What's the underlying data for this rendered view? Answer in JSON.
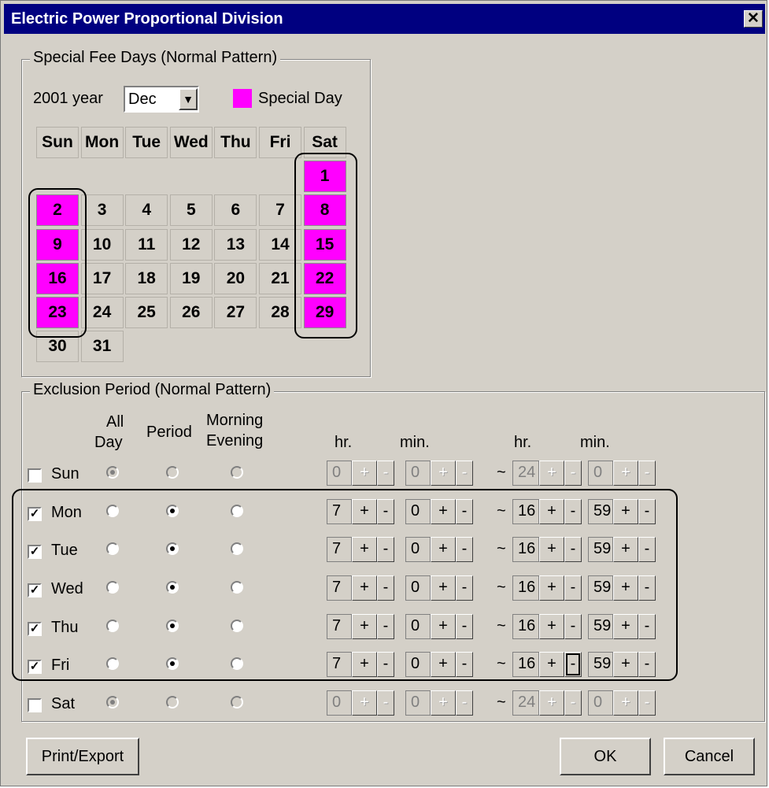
{
  "window": {
    "title": "Electric Power Proportional Division",
    "close_label": "✕"
  },
  "special_fee": {
    "legend": "Special Fee Days (Normal Pattern)",
    "year_label": "2001 year",
    "month_value": "Dec",
    "dropdown_arrow": "▼",
    "special_day_label": "Special Day",
    "special_color": "#ff00ff",
    "weekdays": [
      "Sun",
      "Mon",
      "Tue",
      "Wed",
      "Thu",
      "Fri",
      "Sat"
    ],
    "days": [
      {
        "d": "1",
        "special": true
      },
      {
        "d": "2",
        "special": true
      },
      {
        "d": "3",
        "special": false
      },
      {
        "d": "4",
        "special": false
      },
      {
        "d": "5",
        "special": false
      },
      {
        "d": "6",
        "special": false
      },
      {
        "d": "7",
        "special": false
      },
      {
        "d": "8",
        "special": true
      },
      {
        "d": "9",
        "special": true
      },
      {
        "d": "10",
        "special": false
      },
      {
        "d": "11",
        "special": false
      },
      {
        "d": "12",
        "special": false
      },
      {
        "d": "13",
        "special": false
      },
      {
        "d": "14",
        "special": false
      },
      {
        "d": "15",
        "special": true
      },
      {
        "d": "16",
        "special": true
      },
      {
        "d": "17",
        "special": false
      },
      {
        "d": "18",
        "special": false
      },
      {
        "d": "19",
        "special": false
      },
      {
        "d": "20",
        "special": false
      },
      {
        "d": "21",
        "special": false
      },
      {
        "d": "22",
        "special": true
      },
      {
        "d": "23",
        "special": true
      },
      {
        "d": "24",
        "special": false
      },
      {
        "d": "25",
        "special": false
      },
      {
        "d": "26",
        "special": false
      },
      {
        "d": "27",
        "special": false
      },
      {
        "d": "28",
        "special": false
      },
      {
        "d": "29",
        "special": true
      },
      {
        "d": "30",
        "special": false
      },
      {
        "d": "31",
        "special": false
      }
    ]
  },
  "exclusion": {
    "legend": "Exclusion Period (Normal Pattern)",
    "col_allday": "All\nDay",
    "col_allday_1": "All",
    "col_allday_2": "Day",
    "col_period": "Period",
    "col_morning_1": "Morning",
    "col_morning_2": "Evening",
    "hr_label": "hr.",
    "min_label": "min.",
    "tilde": "~",
    "plus": "+",
    "minus": "-",
    "rows": [
      {
        "day": "Sun",
        "checked": false,
        "mode": "allday",
        "sh": "0",
        "sm": "0",
        "eh": "24",
        "em": "0"
      },
      {
        "day": "Mon",
        "checked": true,
        "mode": "period",
        "sh": "7",
        "sm": "0",
        "eh": "16",
        "em": "59"
      },
      {
        "day": "Tue",
        "checked": true,
        "mode": "period",
        "sh": "7",
        "sm": "0",
        "eh": "16",
        "em": "59"
      },
      {
        "day": "Wed",
        "checked": true,
        "mode": "period",
        "sh": "7",
        "sm": "0",
        "eh": "16",
        "em": "59"
      },
      {
        "day": "Thu",
        "checked": true,
        "mode": "period",
        "sh": "7",
        "sm": "0",
        "eh": "16",
        "em": "59"
      },
      {
        "day": "Fri",
        "checked": true,
        "mode": "period",
        "sh": "7",
        "sm": "0",
        "eh": "16",
        "em": "59"
      },
      {
        "day": "Sat",
        "checked": false,
        "mode": "allday",
        "sh": "0",
        "sm": "0",
        "eh": "24",
        "em": "0"
      }
    ]
  },
  "buttons": {
    "print": "Print/Export",
    "ok": "OK",
    "cancel": "Cancel"
  }
}
